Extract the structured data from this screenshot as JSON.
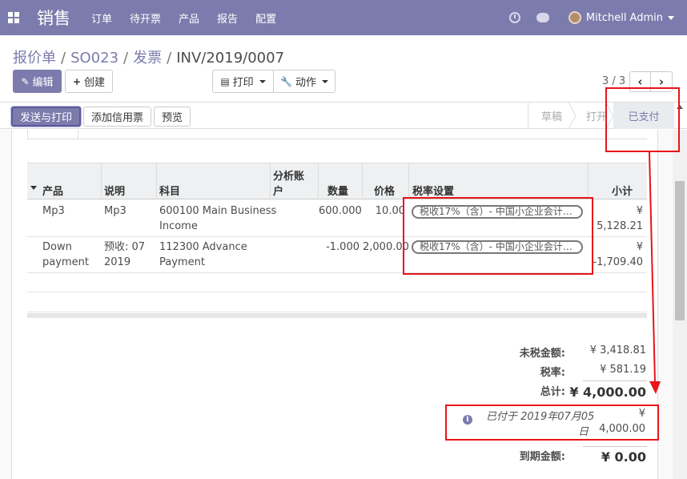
{
  "navbar": {
    "brand": "销售",
    "menu": [
      "订单",
      "待开票",
      "产品",
      "报告",
      "配置"
    ],
    "user": "Mitchell Admin"
  },
  "breadcrumb": {
    "items": [
      "报价单",
      "SO023",
      "发票"
    ],
    "separator": "/",
    "current": "INV/2019/0007"
  },
  "buttons": {
    "edit": "编辑",
    "create": "创建",
    "print": "打印",
    "action": "动作"
  },
  "pager": {
    "value": "3 / 3"
  },
  "statusbar": {
    "send_print": "发送与打印",
    "add_credit": "添加信用票",
    "preview": "预览",
    "stages": [
      "草稿",
      "打开",
      "已支付"
    ],
    "active_stage": "已支付"
  },
  "table": {
    "headers": {
      "product": "产品",
      "description": "说明",
      "account": "科目",
      "analytic_line1": "分析账",
      "analytic_line2": "户",
      "quantity": "数量",
      "price": "价格",
      "taxes": "税率设置",
      "subtotal": "小计"
    },
    "rows": [
      {
        "product": "Mp3",
        "description": "Mp3",
        "account_line1": "600100 Main Business",
        "account_line2": "Income",
        "quantity": "600.000",
        "price": "10.00",
        "tax": "税收17%（含）- 中国小企业会计…",
        "subtotal": "¥ 5,128.21"
      },
      {
        "product_line1": "Down",
        "product_line2": "payment",
        "description_line1": "预收: 07",
        "description_line2": "2019",
        "account_line1": "112300 Advance",
        "account_line2": "Payment",
        "quantity": "-1.000",
        "price": "2,000.00",
        "tax": "税收17%（含）- 中国小企业会计…",
        "subtotal": "¥ -1,709.40"
      }
    ]
  },
  "totals": {
    "untaxed_label": "未税金额:",
    "untaxed_value": "¥ 3,418.81",
    "tax_label": "税率:",
    "tax_value": "¥ 581.19",
    "total_label": "总计:",
    "total_value": "¥ 4,000.00",
    "paid_line1": "已付于 2019年07月05",
    "paid_line2": "日",
    "paid_currency": "¥",
    "paid_amount": "4,000.00",
    "due_label": "到期金额:",
    "due_value": "¥ 0.00"
  },
  "colors": {
    "brand": "#7c7bad",
    "annotation": "#e8141a"
  },
  "icons": [
    "apps-grid-icon",
    "clock-icon",
    "chat-icon",
    "pencil-icon",
    "plus-icon",
    "printer-icon",
    "wrench-icon",
    "chevron-left-icon",
    "chevron-right-icon",
    "info-icon"
  ]
}
